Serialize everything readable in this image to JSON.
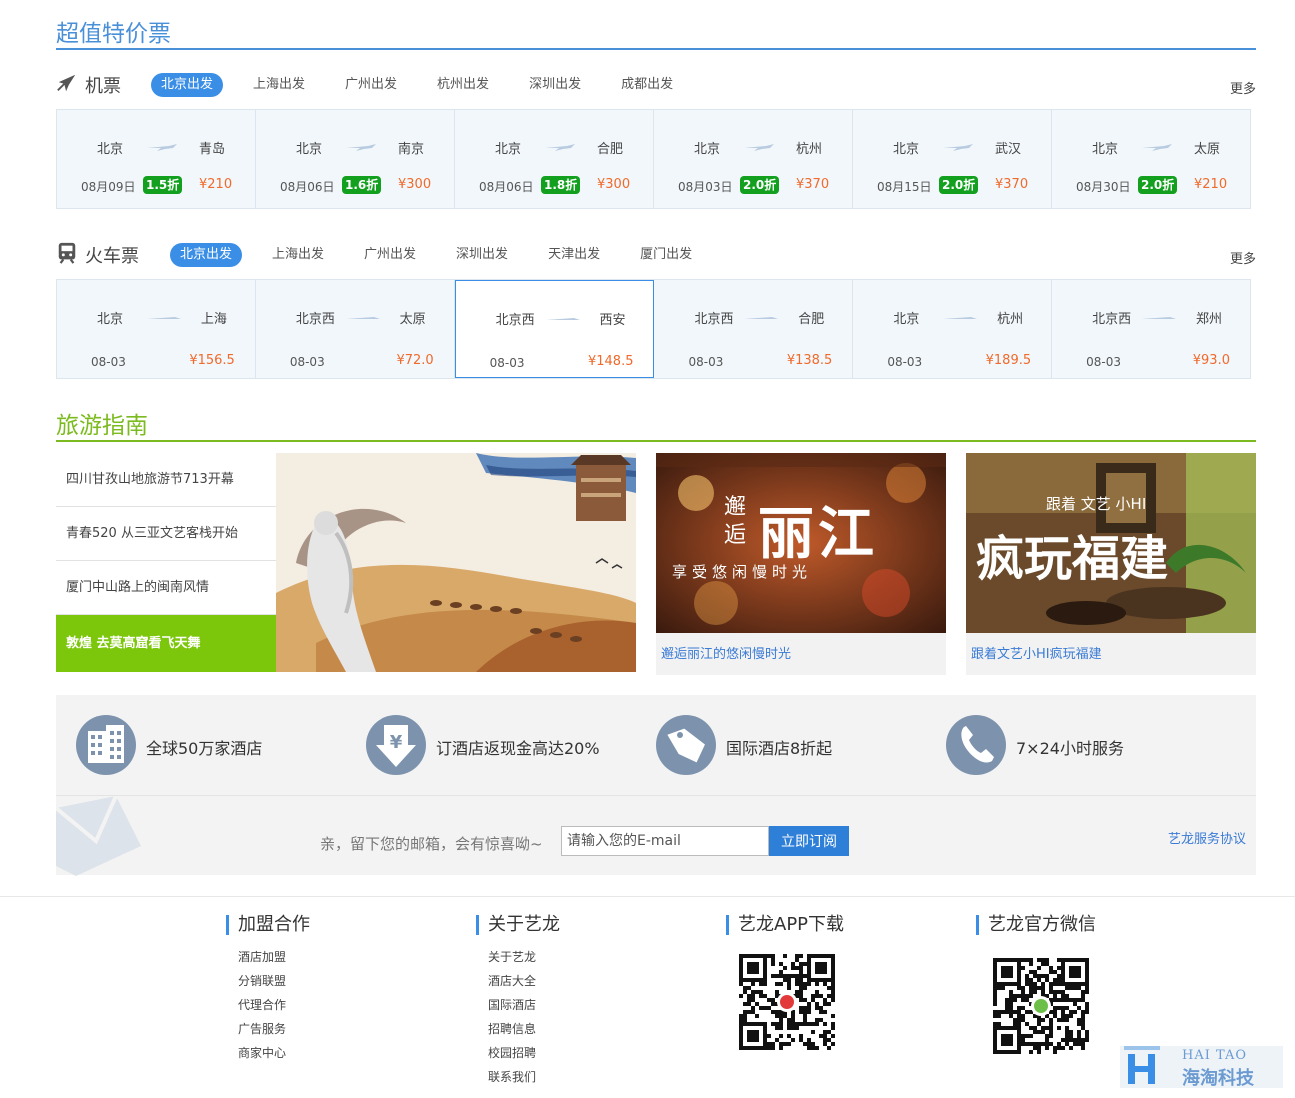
{
  "deals": {
    "title": "超值特价票"
  },
  "flights": {
    "label": "机票",
    "more": "更多",
    "tabs": [
      "北京出发",
      "上海出发",
      "广州出发",
      "杭州出发",
      "深圳出发",
      "成都出发"
    ],
    "active_tab": 0,
    "cards": [
      {
        "from": "北京",
        "to": "青岛",
        "date": "08月09日",
        "discount": "1.5折",
        "price": "¥210"
      },
      {
        "from": "北京",
        "to": "南京",
        "date": "08月06日",
        "discount": "1.6折",
        "price": "¥300"
      },
      {
        "from": "北京",
        "to": "合肥",
        "date": "08月06日",
        "discount": "1.8折",
        "price": "¥300"
      },
      {
        "from": "北京",
        "to": "杭州",
        "date": "08月03日",
        "discount": "2.0折",
        "price": "¥370"
      },
      {
        "from": "北京",
        "to": "武汉",
        "date": "08月15日",
        "discount": "2.0折",
        "price": "¥370"
      },
      {
        "from": "北京",
        "to": "太原",
        "date": "08月30日",
        "discount": "2.0折",
        "price": "¥210"
      }
    ]
  },
  "trains": {
    "label": "火车票",
    "more": "更多",
    "tabs": [
      "北京出发",
      "上海出发",
      "广州出发",
      "深圳出发",
      "天津出发",
      "厦门出发"
    ],
    "active_tab": 0,
    "cards": [
      {
        "from": "北京",
        "to": "上海",
        "date": "08-03",
        "price": "¥156.5"
      },
      {
        "from": "北京西",
        "to": "太原",
        "date": "08-03",
        "price": "¥72.0"
      },
      {
        "from": "北京西",
        "to": "西安",
        "date": "08-03",
        "price": "¥148.5"
      },
      {
        "from": "北京西",
        "to": "合肥",
        "date": "08-03",
        "price": "¥138.5"
      },
      {
        "from": "北京",
        "to": "杭州",
        "date": "08-03",
        "price": "¥189.5"
      },
      {
        "from": "北京西",
        "to": "郑州",
        "date": "08-03",
        "price": "¥93.0"
      }
    ]
  },
  "guide": {
    "title": "旅游指南",
    "items": [
      "四川甘孜山地旅游节713开幕",
      "青春520 从三亚文艺客栈开始",
      "厦门中山路上的闽南风情",
      "敦煌 去莫高窟看飞天舞"
    ],
    "active_item": 3,
    "promos": [
      {
        "caption": "邂逅丽江的悠闲慢时光",
        "art_small_1": "邂",
        "art_small_2": "逅",
        "art_big": "丽江",
        "art_line": "享受悠闲慢时光"
      },
      {
        "caption": "跟着文艺小HI疯玩福建",
        "art_top": "跟着 文艺 小HI",
        "art_big": "疯玩福建"
      }
    ]
  },
  "features": [
    {
      "icon": "hotel-building-icon",
      "text": "全球50万家酒店"
    },
    {
      "icon": "yen-cashback-icon",
      "text": "订酒店返现金高达20%"
    },
    {
      "icon": "price-tag-icon",
      "text": "国际酒店8折起"
    },
    {
      "icon": "phone-icon",
      "text": "7×24小时服务"
    }
  ],
  "subscribe": {
    "prompt": "亲，留下您的邮箱，会有惊喜呦~",
    "placeholder": "请输入您的E-mail",
    "button": "立即订阅",
    "terms": "艺龙服务协议"
  },
  "footer": {
    "join": {
      "title": "加盟合作",
      "links": [
        "酒店加盟",
        "分销联盟",
        "代理合作",
        "广告服务",
        "商家中心"
      ]
    },
    "about": {
      "title": "关于艺龙",
      "links": [
        "关于艺龙",
        "酒店大全",
        "国际酒店",
        "招聘信息",
        "校园招聘",
        "联系我们"
      ]
    },
    "app": {
      "title": "艺龙APP下载"
    },
    "wechat": {
      "title": "艺龙官方微信"
    }
  },
  "watermark": {
    "en": "HAI TAO",
    "cn": "海淘科技"
  },
  "colors": {
    "accent_blue": "#3a8ee6",
    "guide_green": "#7cc70b",
    "price_orange": "#f06a2b",
    "discount_green": "#13a01f",
    "feature_icon": "#7d93ad"
  }
}
